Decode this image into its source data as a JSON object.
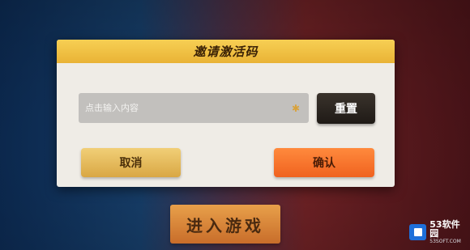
{
  "dialog": {
    "title": "邀请激活码",
    "code_input_placeholder": "点击输入内容",
    "reset_label": "重置",
    "cancel_label": "取消",
    "confirm_label": "确认"
  },
  "background": {
    "enter_game_label": "进入游戏"
  },
  "brand": {
    "name": "53软件园",
    "url": "53SOFT.COM"
  },
  "colors": {
    "header_gold": "#f2c445",
    "confirm_orange": "#f2702a",
    "cancel_gold": "#e4b85b",
    "reset_dark": "#2a241f"
  }
}
